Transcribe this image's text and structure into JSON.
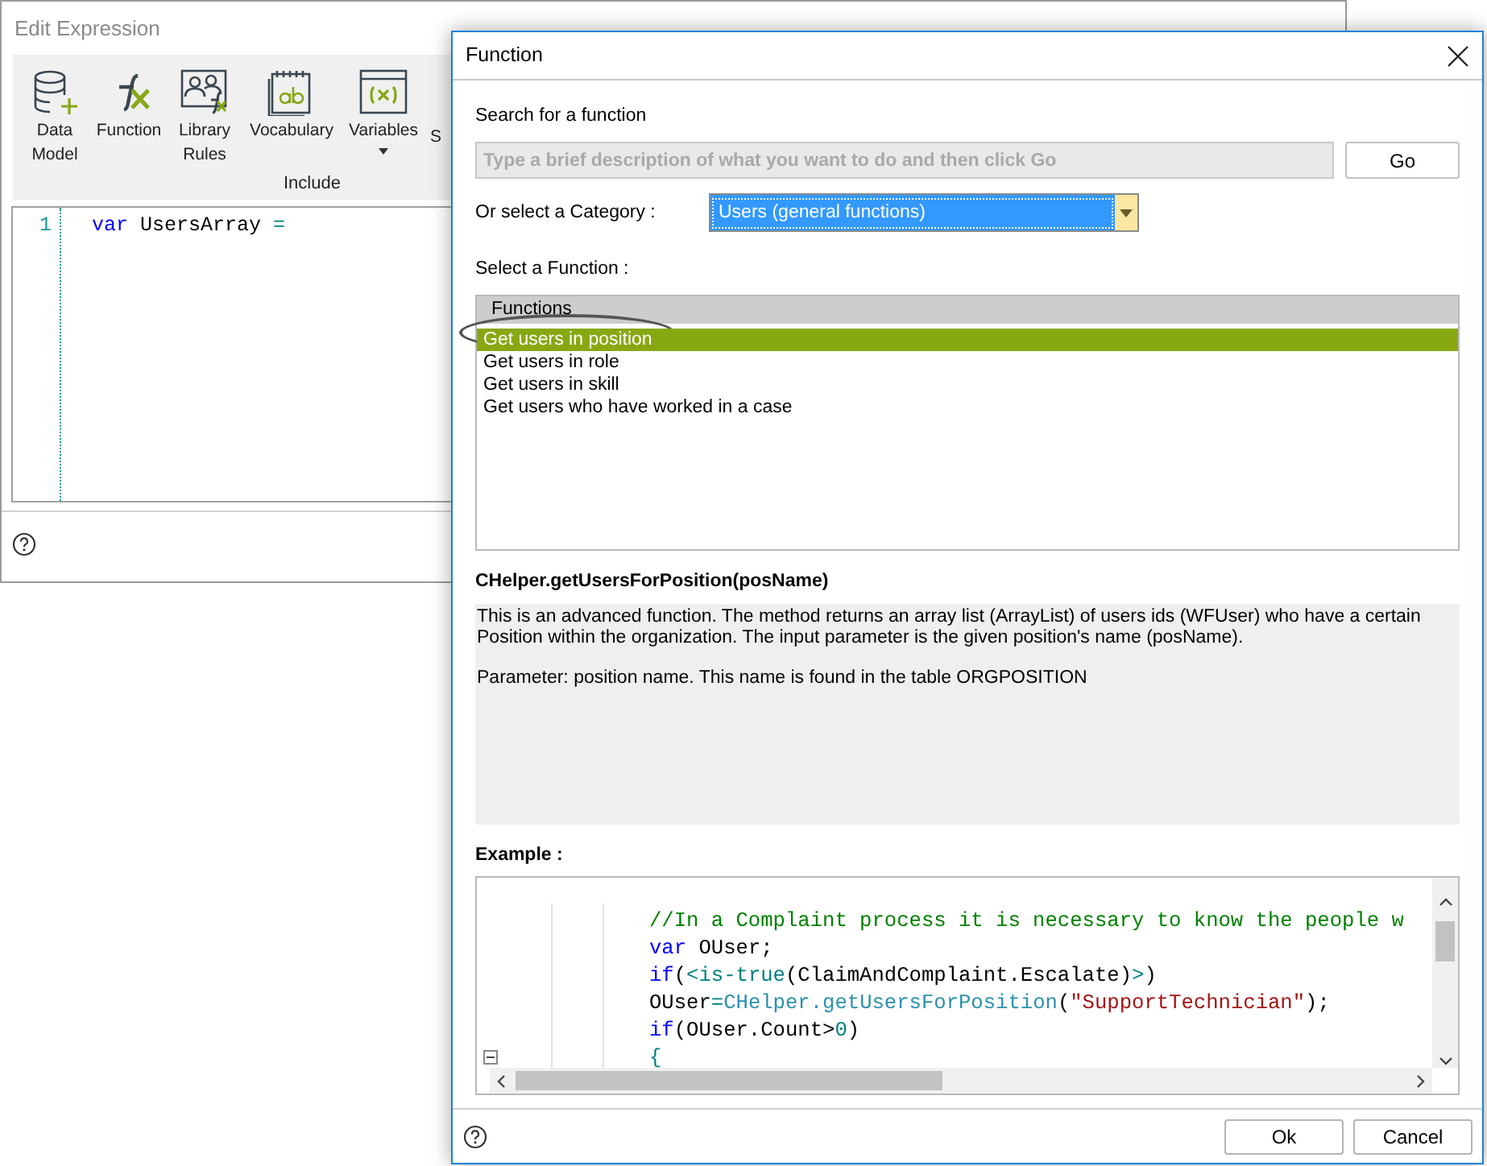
{
  "edit_expression": {
    "title": "Edit Expression",
    "toolbar": {
      "buttons": [
        {
          "kind": "database",
          "label": "Data Model"
        },
        {
          "kind": "function",
          "label": "Function"
        },
        {
          "kind": "library",
          "label": "Library Rules"
        },
        {
          "kind": "vocabulary",
          "label": "Vocabulary"
        },
        {
          "kind": "variables",
          "label": "Variables"
        },
        {
          "kind": "text",
          "label": "S"
        }
      ],
      "group_label": "Include"
    },
    "editor": {
      "lines": [
        {
          "number": "1",
          "tokens": [
            {
              "kind": "keyword",
              "text": "var"
            },
            {
              "kind": "plain",
              "text": " UsersArray "
            },
            {
              "kind": "tag",
              "text": "="
            }
          ]
        }
      ]
    }
  },
  "function_dialog": {
    "title": "Function",
    "search": {
      "label": "Search for a function",
      "placeholder": "Type a brief description of what you want to do and then click Go",
      "button": "Go"
    },
    "category": {
      "label": "Or select a Category :",
      "value": "Users (general functions)"
    },
    "function_list": {
      "label": "Select a Function :",
      "header": "Functions",
      "items": [
        {
          "label": "Get users in position",
          "selected": true
        },
        {
          "label": "Get users in role",
          "selected": false
        },
        {
          "label": "Get users in skill",
          "selected": false
        },
        {
          "label": "Get users who have worked in a case",
          "selected": false
        }
      ]
    },
    "signature": "CHelper.getUsersForPosition(posName)",
    "description": [
      "This is an advanced function. The method returns an array list (ArrayList) of users ids (WFUser) who have a certain Position within the organization. The input parameter is the given position's name (posName).",
      "Parameter: position name. This name is found in the table ORGPOSITION"
    ],
    "example": {
      "label": "Example :",
      "lines": [
        [
          {
            "kind": "comment",
            "text": "//In a Complaint process it is necessary to know the people w"
          }
        ],
        [
          {
            "kind": "keyword",
            "text": "var"
          },
          {
            "kind": "plain",
            "text": " OUser;"
          }
        ],
        [
          {
            "kind": "keyword",
            "text": "if"
          },
          {
            "kind": "plain",
            "text": "("
          },
          {
            "kind": "tag",
            "text": "<is-true"
          },
          {
            "kind": "plain",
            "text": "(ClaimAndComplaint.Escalate)"
          },
          {
            "kind": "tag",
            "text": ">"
          },
          {
            "kind": "plain",
            "text": ")"
          }
        ],
        [
          {
            "kind": "plain",
            "text": "OUser"
          },
          {
            "kind": "tag",
            "text": "="
          },
          {
            "kind": "method",
            "text": "CHelper.getUsersForPosition"
          },
          {
            "kind": "plain",
            "text": "("
          },
          {
            "kind": "string",
            "text": "\"SupportTechnician\""
          },
          {
            "kind": "plain",
            "text": ");"
          }
        ],
        [
          {
            "kind": "keyword",
            "text": "if"
          },
          {
            "kind": "plain",
            "text": "(OUser.Count>"
          },
          {
            "kind": "tag",
            "text": "0"
          },
          {
            "kind": "plain",
            "text": ")"
          }
        ],
        [
          {
            "kind": "tag",
            "text": "{"
          }
        ]
      ]
    },
    "buttons": [
      "Ok",
      "Cancel"
    ]
  }
}
